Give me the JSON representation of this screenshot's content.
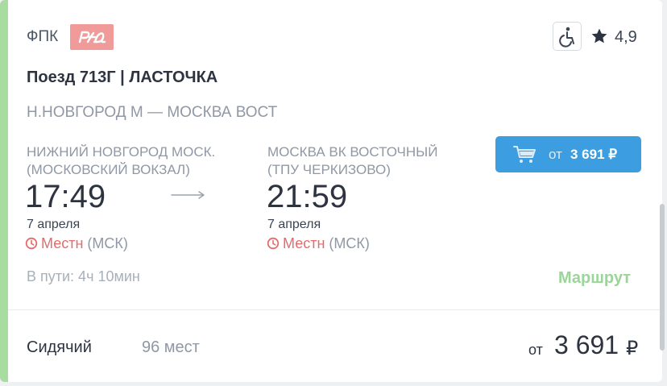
{
  "header": {
    "carrier": "ФПК",
    "logo_text": "РЖД",
    "rating": "4,9"
  },
  "train": {
    "title": "Поезд 713Г | ЛАСТОЧКА",
    "route": "Н.НОВГОРОД М — МОСКВА ВОСТ"
  },
  "departure": {
    "station_line1": "НИЖНИЙ НОВГОРОД МОСК.",
    "station_line2": "(МОСКОВСКИЙ ВОКЗАЛ)",
    "time": "17:49",
    "date": "7 апреля",
    "tz_local": "Местн",
    "tz_zone": "(МСК)"
  },
  "arrival": {
    "station_line1": "МОСКВА ВК ВОСТОЧНЫЙ",
    "station_line2": "(ТПУ ЧЕРКИЗОВО)",
    "time": "21:59",
    "date": "7 апреля",
    "tz_local": "Местн",
    "tz_zone": "(МСК)"
  },
  "buy": {
    "prefix": "от",
    "price": "3 691 ₽"
  },
  "duration": "В пути: 4ч 10мин",
  "route_link": "Маршрут",
  "fare": {
    "class_name": "Сидячий",
    "seats": "96 мест",
    "price_prefix": "от",
    "price_value": "3 691",
    "currency": "₽"
  },
  "colors": {
    "accent": "#a8dca0",
    "button": "#3c9ee0",
    "local_time": "#e36b6b",
    "route_link": "#9bd59a"
  },
  "icons": [
    "rzd-logo",
    "wheelchair-icon",
    "star-icon",
    "arrow-right-icon",
    "clock-icon",
    "cart-icon"
  ]
}
